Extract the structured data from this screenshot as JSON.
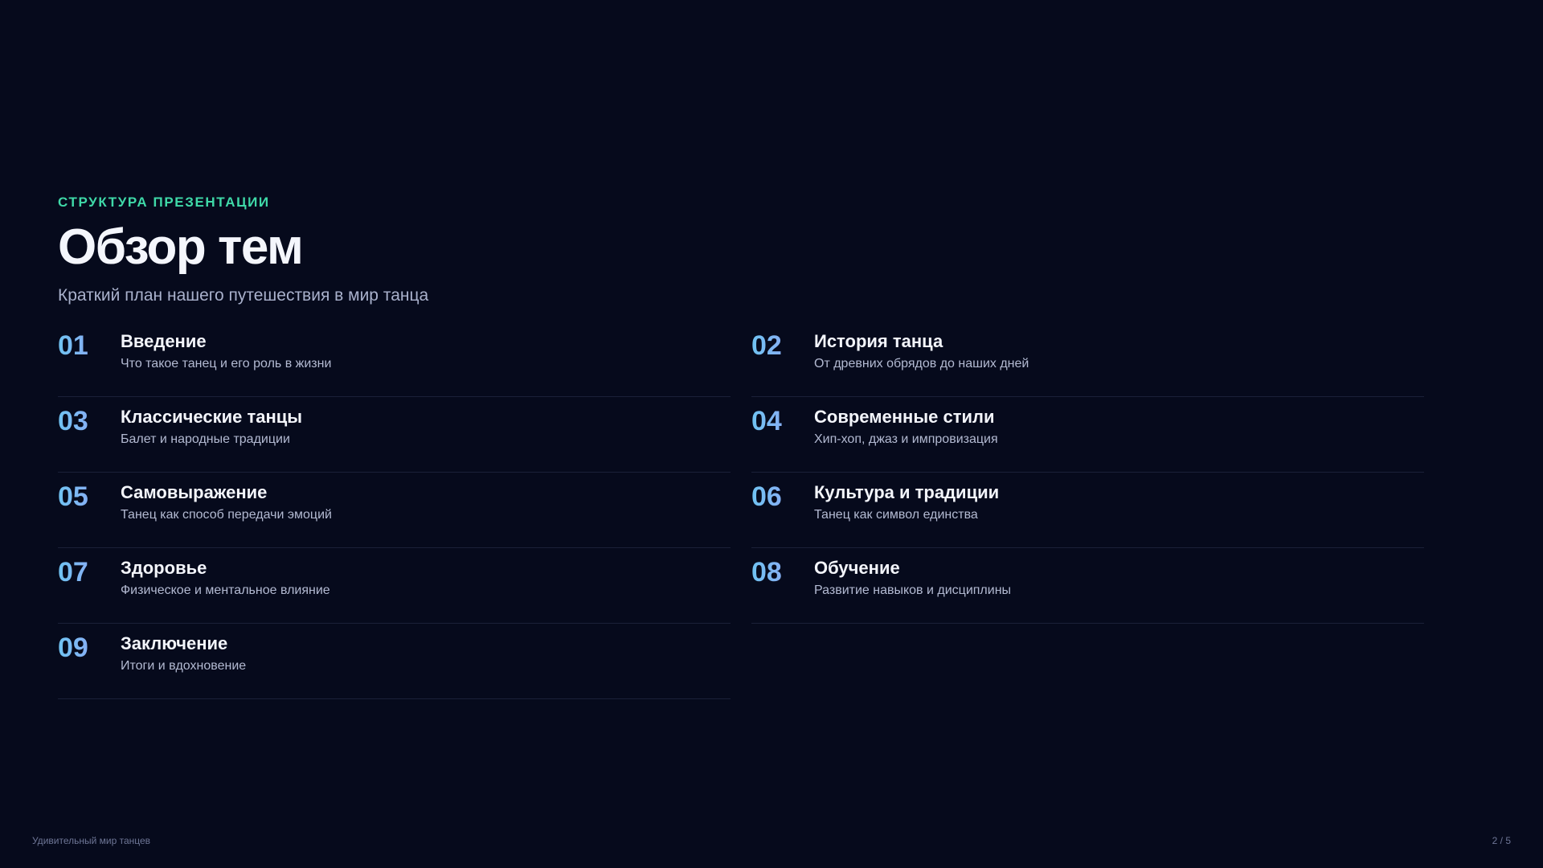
{
  "header": {
    "eyebrow": "СТРУКТУРА ПРЕЗЕНТАЦИИ",
    "title": "Обзор тем",
    "subtitle": "Краткий план нашего путешествия в мир танца"
  },
  "topics": [
    {
      "number": "01",
      "title": "Введение",
      "description": "Что такое танец и его роль в жизни"
    },
    {
      "number": "02",
      "title": "История танца",
      "description": "От древних обрядов до наших дней"
    },
    {
      "number": "03",
      "title": "Классические танцы",
      "description": "Балет и народные традиции"
    },
    {
      "number": "04",
      "title": "Современные стили",
      "description": "Хип-хоп, джаз и импровизация"
    },
    {
      "number": "05",
      "title": "Самовыражение",
      "description": "Танец как способ передачи эмоций"
    },
    {
      "number": "06",
      "title": "Культура и традиции",
      "description": "Танец как символ единства"
    },
    {
      "number": "07",
      "title": "Здоровье",
      "description": "Физическое и ментальное влияние"
    },
    {
      "number": "08",
      "title": "Обучение",
      "description": "Развитие навыков и дисциплины"
    },
    {
      "number": "09",
      "title": "Заключение",
      "description": "Итоги и вдохновение"
    }
  ],
  "footer": {
    "presentation_name": "Удивительный мир танцев",
    "page_indicator": "2 / 5"
  },
  "colors": {
    "background": "#060a1c",
    "accent": "#3fd9a8",
    "number_gradient_start": "#6fc3f2",
    "number_gradient_end": "#9d9cf6"
  }
}
